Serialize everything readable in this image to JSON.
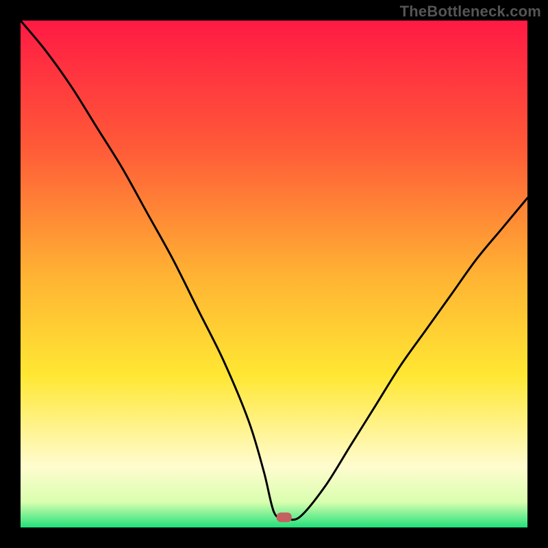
{
  "watermark": "TheBottleneck.com",
  "chart_data": {
    "type": "line",
    "title": "",
    "xlabel": "",
    "ylabel": "",
    "xlim": [
      0,
      100
    ],
    "ylim": [
      0,
      100
    ],
    "grid": false,
    "legend": false,
    "background_gradient": {
      "stops": [
        {
          "offset": 0.0,
          "color": "#ff1a44"
        },
        {
          "offset": 0.25,
          "color": "#ff5a38"
        },
        {
          "offset": 0.5,
          "color": "#ffb233"
        },
        {
          "offset": 0.7,
          "color": "#ffe733"
        },
        {
          "offset": 0.88,
          "color": "#fffccf"
        },
        {
          "offset": 0.95,
          "color": "#d9ffaf"
        },
        {
          "offset": 1.0,
          "color": "#22e07a"
        }
      ]
    },
    "marker": {
      "x": 52,
      "y": 2,
      "color": "#c46060"
    },
    "series": [
      {
        "name": "bottleneck-curve",
        "x": [
          0,
          5,
          10,
          15,
          20,
          25,
          30,
          35,
          40,
          45,
          48,
          50,
          52,
          55,
          60,
          65,
          70,
          75,
          80,
          85,
          90,
          95,
          100
        ],
        "y": [
          100,
          94,
          87,
          79,
          71,
          62,
          53,
          43,
          33,
          21,
          11,
          3,
          2,
          2,
          8,
          16,
          24,
          32,
          39,
          46,
          53,
          59,
          65
        ]
      }
    ]
  }
}
